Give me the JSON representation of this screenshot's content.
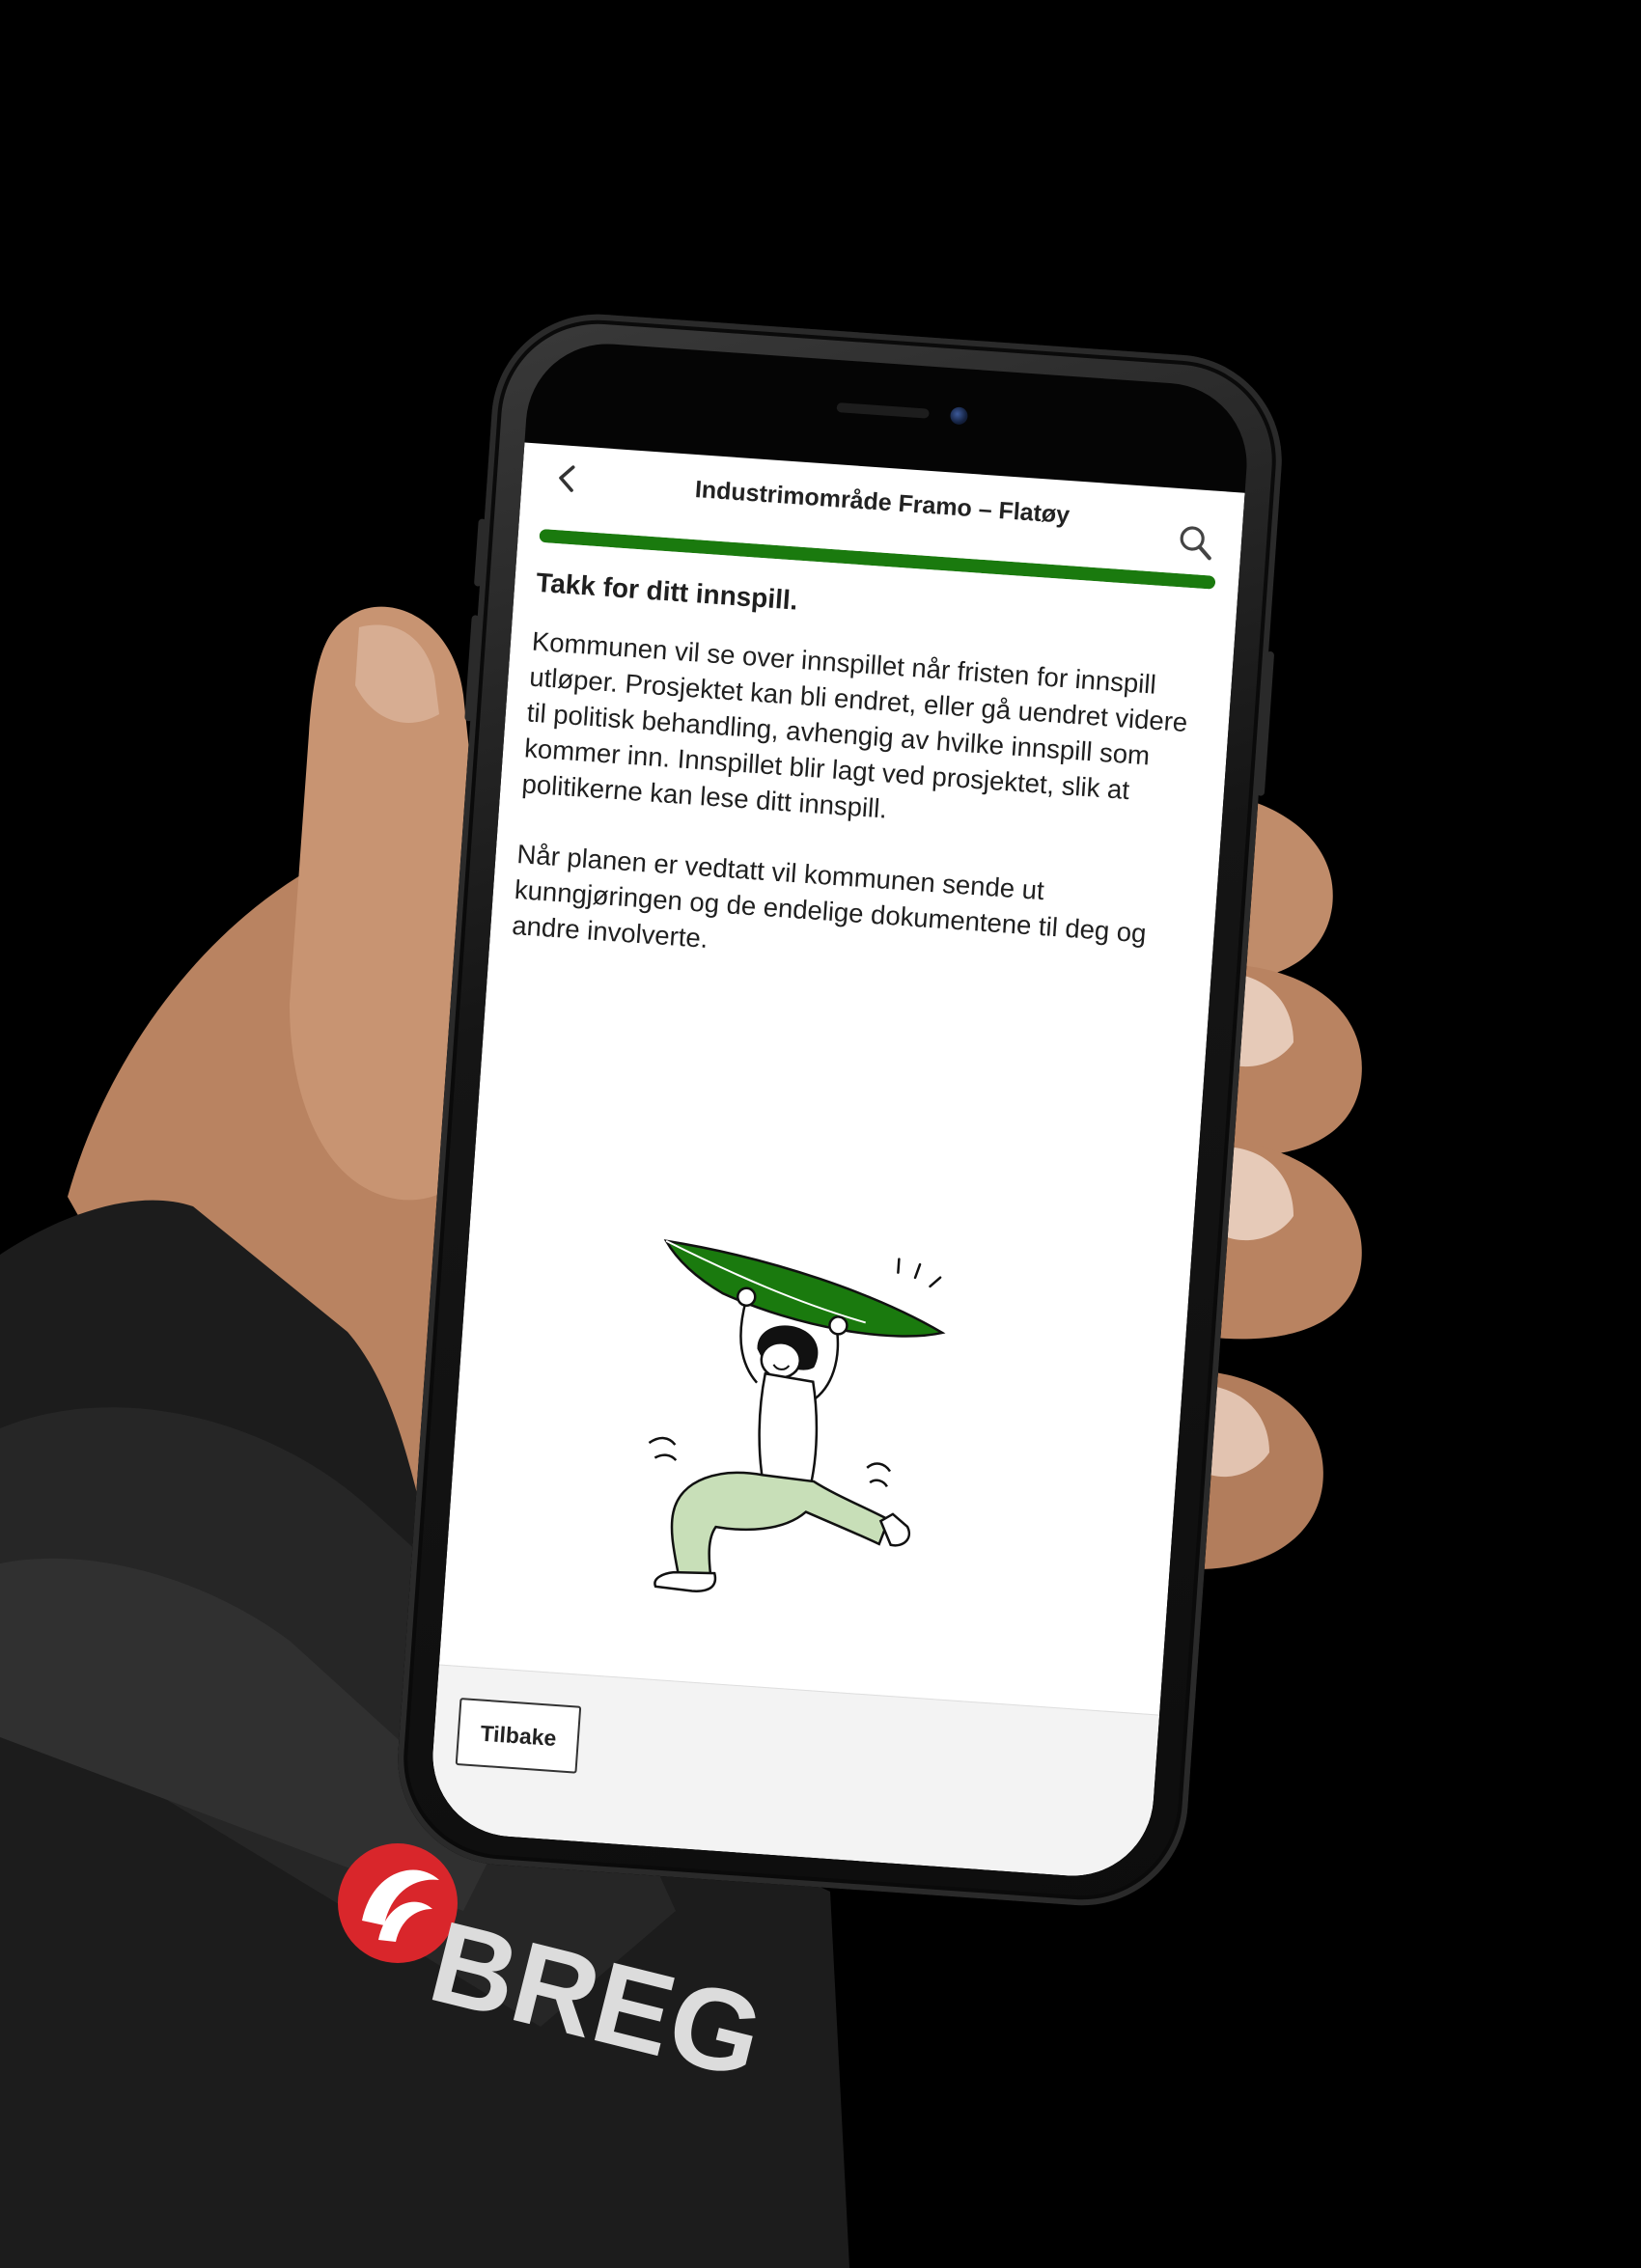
{
  "header": {
    "title": "Industrimområde Framo – Flatøy",
    "back_icon": "chevron-left-icon",
    "search_icon": "search-icon"
  },
  "progress": {
    "percent": 100,
    "color": "#1a7a0e"
  },
  "main": {
    "heading": "Takk for ditt innspill.",
    "paragraph_1": "Kommunen vil se over innspillet når fristen for innspill utløper. Prosjektet kan bli endret, eller gå uendret videre til politisk behandling, avhengig av hvilke innspill som kommer inn. Innspillet blir lagt ved prosjektet, slik at politikerne kan lese ditt innspill.",
    "paragraph_2": "Når planen er vedtatt vil kommunen sende ut kunngjøringen og de endelige dokumentene til deg og andre involverte."
  },
  "illustration": {
    "icon": "celebrating-person-illustration",
    "accent_color": "#1a7a0e",
    "pants_color": "#c8dfb8"
  },
  "footer": {
    "back_button_label": "Tilbake"
  },
  "glove_logo": {
    "text": "BREG",
    "color": "#d9262b"
  }
}
